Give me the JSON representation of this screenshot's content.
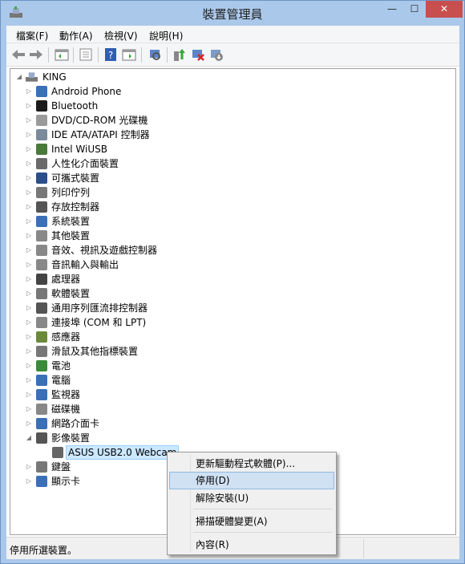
{
  "window": {
    "title": "裝置管理員",
    "minimize": "—",
    "maximize": "☐",
    "close": "✕"
  },
  "menu": [
    "檔案(F)",
    "動作(A)",
    "檢視(V)",
    "說明(H)"
  ],
  "toolbar": [
    "back",
    "forward",
    "show-hide-console-tree",
    "properties",
    "help",
    "action-pane",
    "scan-hardware",
    "update-driver",
    "uninstall",
    "disable"
  ],
  "tree": {
    "root": "KING",
    "items": [
      {
        "label": "Android Phone",
        "icon": "phone-icon",
        "color": "#3b6fb6"
      },
      {
        "label": "Bluetooth",
        "icon": "bluetooth-icon",
        "color": "#1b1b1b"
      },
      {
        "label": "DVD/CD-ROM 光碟機",
        "icon": "dvd-drive-icon",
        "color": "#9a9a9a"
      },
      {
        "label": "IDE ATA/ATAPI 控制器",
        "icon": "ide-controller-icon",
        "color": "#7a8a9a"
      },
      {
        "label": "Intel WiUSB",
        "icon": "usb-icon",
        "color": "#4a7a3a"
      },
      {
        "label": "人性化介面裝置",
        "icon": "hid-icon",
        "color": "#6a6a6a"
      },
      {
        "label": "可攜式裝置",
        "icon": "portable-device-icon",
        "color": "#2b4f8a"
      },
      {
        "label": "列印佇列",
        "icon": "printer-icon",
        "color": "#777777"
      },
      {
        "label": "存放控制器",
        "icon": "storage-controller-icon",
        "color": "#555555"
      },
      {
        "label": "系統裝置",
        "icon": "system-device-icon",
        "color": "#3b6fb6"
      },
      {
        "label": "其他裝置",
        "icon": "other-device-icon",
        "color": "#888888"
      },
      {
        "label": "音效、視訊及遊戲控制器",
        "icon": "speaker-icon",
        "color": "#888888"
      },
      {
        "label": "音訊輸入與輸出",
        "icon": "audio-io-icon",
        "color": "#888888"
      },
      {
        "label": "處理器",
        "icon": "processor-icon",
        "color": "#444444"
      },
      {
        "label": "軟體裝置",
        "icon": "software-device-icon",
        "color": "#777777"
      },
      {
        "label": "通用序列匯流排控制器",
        "icon": "usb-controller-icon",
        "color": "#555555"
      },
      {
        "label": "連接埠 (COM 和 LPT)",
        "icon": "port-icon",
        "color": "#888888"
      },
      {
        "label": "感應器",
        "icon": "sensor-icon",
        "color": "#6a8a3a"
      },
      {
        "label": "滑鼠及其他指標裝置",
        "icon": "mouse-icon",
        "color": "#777777"
      },
      {
        "label": "電池",
        "icon": "battery-icon",
        "color": "#3a8a3a"
      },
      {
        "label": "電腦",
        "icon": "computer-icon",
        "color": "#3b6fb6"
      },
      {
        "label": "監視器",
        "icon": "monitor-icon",
        "color": "#3b6fb6"
      },
      {
        "label": "磁碟機",
        "icon": "disk-drive-icon",
        "color": "#888888"
      },
      {
        "label": "網路介面卡",
        "icon": "network-adapter-icon",
        "color": "#3b6fb6"
      },
      {
        "label": "影像裝置",
        "icon": "imaging-device-icon",
        "color": "#555555",
        "expanded": true,
        "children": [
          {
            "label": "ASUS USB2.0 Webcam",
            "icon": "webcam-icon",
            "color": "#666666",
            "selected": true
          }
        ]
      },
      {
        "label": "鍵盤",
        "icon": "keyboard-icon",
        "color": "#777777"
      },
      {
        "label": "顯示卡",
        "icon": "display-adapter-icon",
        "color": "#3b6fb6"
      }
    ]
  },
  "context_menu": {
    "items": [
      "更新驅動程式軟體(P)...",
      "停用(D)",
      "解除安裝(U)",
      "掃描硬體變更(A)",
      "內容(R)"
    ],
    "highlighted": "停用(D)"
  },
  "status": "停用所選裝置。"
}
